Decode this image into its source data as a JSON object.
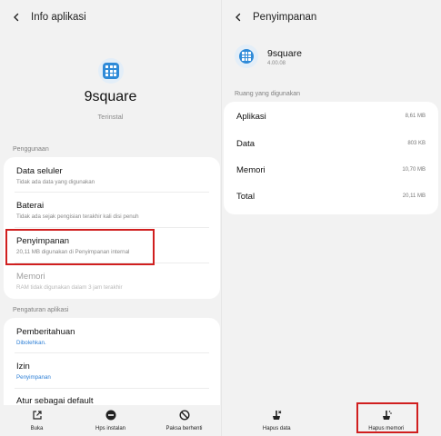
{
  "left": {
    "header": {
      "title": "Info aplikasi",
      "back_icon": "chevron-left-icon"
    },
    "app": {
      "name": "9square",
      "status": "Terinstal",
      "icon": "grid-app-icon"
    },
    "sections": {
      "usage_label": "Penggunaan",
      "settings_label": "Pengaturan aplikasi"
    },
    "usage_items": [
      {
        "title": "Data seluler",
        "sub": "Tidak ada data yang digunakan"
      },
      {
        "title": "Baterai",
        "sub": "Tidak ada sejak pengisian terakhir kali disi penuh"
      },
      {
        "title": "Penyimpanan",
        "sub": "20,11 MB digunakan di Penyimpanan internal"
      },
      {
        "title": "Memori",
        "sub": "RAM tidak digunakan dalam 3 jam terakhir"
      }
    ],
    "settings_items": [
      {
        "title": "Pemberitahuan",
        "sub": "Dibolehkan."
      },
      {
        "title": "Izin",
        "sub": "Penyimpanan"
      },
      {
        "title": "Atur sebagai default",
        "sub": ""
      }
    ],
    "bottom_actions": [
      {
        "label": "Buka",
        "icon": "open-external-icon"
      },
      {
        "label": "Hps instalan",
        "icon": "uninstall-icon"
      },
      {
        "label": "Paksa berhenti",
        "icon": "force-stop-icon"
      }
    ]
  },
  "right": {
    "header": {
      "title": "Penyimpanan",
      "back_icon": "chevron-left-icon"
    },
    "app": {
      "name": "9square",
      "version": "4.00.08",
      "icon": "grid-app-icon"
    },
    "section_label": "Ruang yang digunakan",
    "rows": [
      {
        "label": "Aplikasi",
        "value": "8,61 MB"
      },
      {
        "label": "Data",
        "value": "803 KB"
      },
      {
        "label": "Memori",
        "value": "10,70 MB"
      },
      {
        "label": "Total",
        "value": "20,11 MB"
      }
    ],
    "bottom_actions": [
      {
        "label": "Hapus data",
        "icon": "clear-data-icon"
      },
      {
        "label": "Hapus memori",
        "icon": "clear-cache-icon"
      }
    ]
  },
  "colors": {
    "highlight": "#d01f1f",
    "accent": "#2d7fd6",
    "app_icon": "#2e8ad8",
    "background": "#f2f2f2"
  }
}
